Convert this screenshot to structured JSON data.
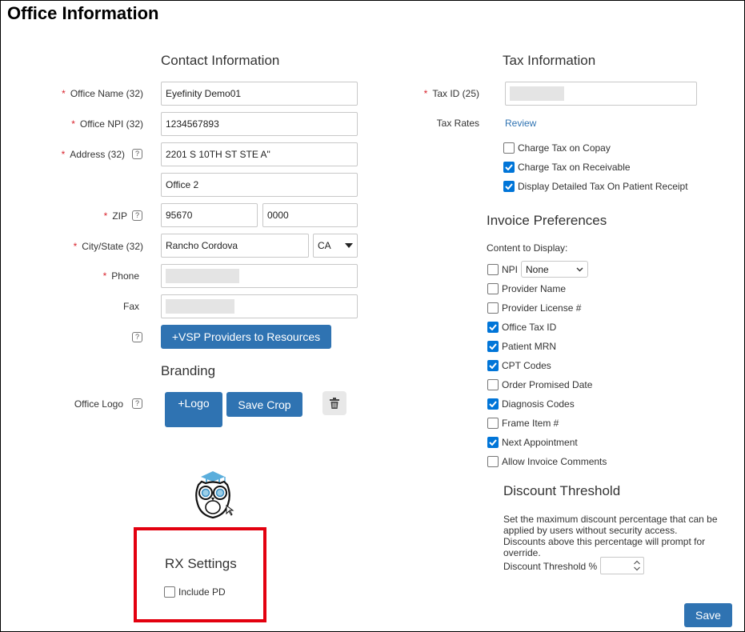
{
  "page": {
    "title": "Office Information"
  },
  "contact": {
    "title": "Contact Information",
    "office_name": {
      "label": "Office Name (32)",
      "value": "Eyefinity  Demo01"
    },
    "office_npi": {
      "label": "Office NPI (32)",
      "value": "1234567893"
    },
    "address": {
      "label": "Address (32)",
      "line1": "2201 S 10TH ST STE A\"",
      "line2": "Office 2"
    },
    "zip": {
      "label": "ZIP",
      "value": "95670",
      "ext": "0000"
    },
    "city_state": {
      "label": "City/State (32)",
      "city": "Rancho Cordova",
      "state": "CA"
    },
    "phone": {
      "label": "Phone"
    },
    "fax": {
      "label": "Fax"
    },
    "vsp_button": "+VSP Providers to Resources"
  },
  "branding": {
    "title": "Branding",
    "logo_label": "Office Logo",
    "add_logo": "+Logo",
    "save_crop": "Save Crop"
  },
  "rx": {
    "title": "RX Settings",
    "include_pd": "Include PD",
    "include_pd_checked": false
  },
  "tax": {
    "title": "Tax Information",
    "tax_id_label": "Tax ID (25)",
    "tax_rates_label": "Tax Rates",
    "review_link": "Review",
    "options": [
      {
        "label": "Charge Tax on Copay",
        "checked": false
      },
      {
        "label": "Charge Tax on Receivable",
        "checked": true
      },
      {
        "label": "Display Detailed Tax On Patient Receipt",
        "checked": true
      }
    ]
  },
  "invoice": {
    "title": "Invoice Preferences",
    "content_label": "Content to Display:",
    "npi_label": "NPI",
    "npi_select": "None",
    "items": [
      {
        "label": "Provider Name",
        "checked": false
      },
      {
        "label": "Provider License #",
        "checked": false
      },
      {
        "label": "Office Tax ID",
        "checked": true
      },
      {
        "label": "Patient MRN",
        "checked": true
      },
      {
        "label": "CPT Codes",
        "checked": true
      },
      {
        "label": "Order Promised Date",
        "checked": false
      },
      {
        "label": "Diagnosis Codes",
        "checked": true
      },
      {
        "label": "Frame Item #",
        "checked": false
      },
      {
        "label": "Next Appointment",
        "checked": true
      },
      {
        "label": "Allow Invoice Comments",
        "checked": false
      }
    ]
  },
  "discount": {
    "title": "Discount Threshold",
    "description": "Set the maximum discount percentage that can be applied by users without security access. Discounts above this percentage will prompt for override.",
    "field_label": "Discount Threshold %",
    "value": ""
  },
  "actions": {
    "save": "Save"
  },
  "colors": {
    "primary_button": "#2f73b2",
    "checkbox_checked": "#0075d8",
    "required": "#d9232d",
    "highlight": "#e3000f"
  }
}
